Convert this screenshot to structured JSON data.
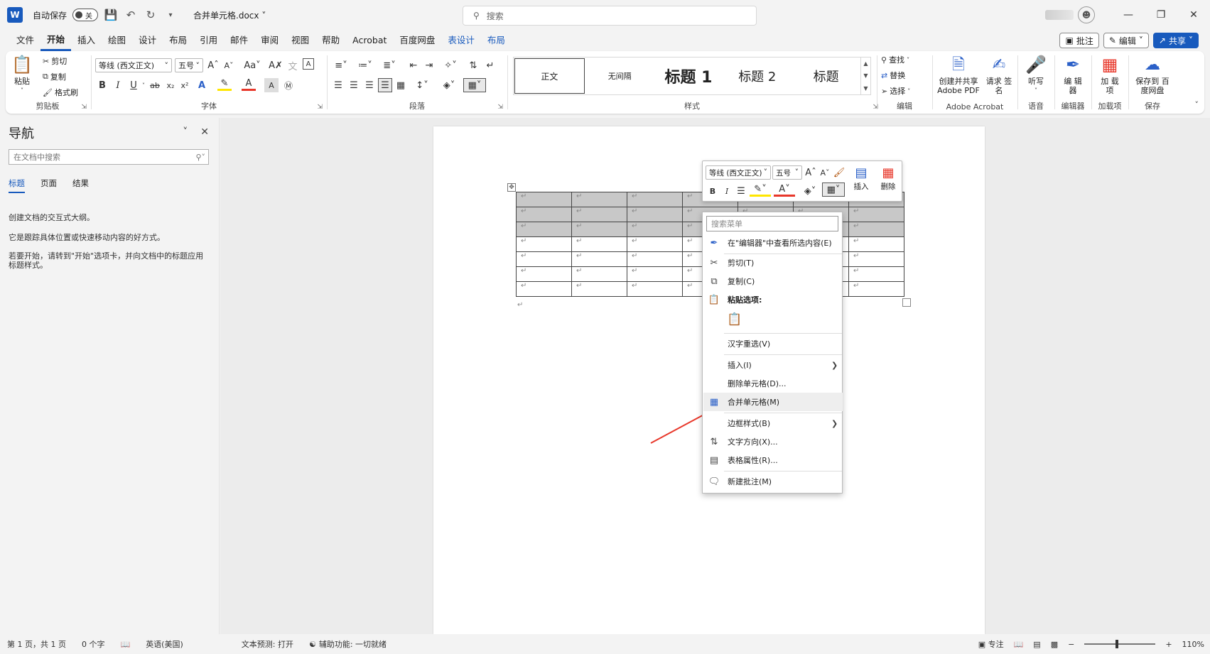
{
  "titlebar": {
    "app_logo": "W",
    "autosave_label": "自动保存",
    "autosave_state": "关",
    "doc_title": "合并单元格.docx",
    "search_placeholder": "搜索"
  },
  "menubar": {
    "tabs": [
      "文件",
      "开始",
      "插入",
      "绘图",
      "设计",
      "布局",
      "引用",
      "邮件",
      "审阅",
      "视图",
      "帮助",
      "Acrobat",
      "百度网盘",
      "表设计",
      "布局"
    ],
    "comment_btn": "批注",
    "edit_btn": "编辑",
    "share_btn": "共享"
  },
  "ribbon": {
    "clipboard": {
      "label": "剪贴板",
      "paste": "粘贴",
      "cut": "剪切",
      "copy": "复制",
      "format_painter": "格式刷"
    },
    "font": {
      "label": "字体",
      "font_name": "等线 (西文正文)",
      "font_size": "五号",
      "bold": "B",
      "italic": "I",
      "underline": "U",
      "strike": "ab",
      "sub": "x₂",
      "sup": "x²",
      "change_case": "Aa"
    },
    "paragraph": {
      "label": "段落"
    },
    "styles": {
      "label": "样式",
      "items": [
        "正文",
        "无间隔",
        "标题 1",
        "标题 2",
        "标题"
      ]
    },
    "editing": {
      "label": "编辑",
      "find": "查找",
      "replace": "替换",
      "select": "选择"
    },
    "acrobat": {
      "label": "Adobe Acrobat",
      "create_share": "创建并共享 Adobe PDF",
      "request_sign": "请求 签名"
    },
    "voice": {
      "label": "语音",
      "dictate": "听写"
    },
    "editor": {
      "label": "编辑器",
      "editor_btn": "编 辑器"
    },
    "addins": {
      "label": "加载项",
      "addins_btn": "加 载项"
    },
    "save": {
      "label": "保存",
      "save_baidu": "保存到 百度网盘"
    }
  },
  "nav": {
    "title": "导航",
    "search_placeholder": "在文档中搜索",
    "tabs": [
      "标题",
      "页面",
      "结果"
    ],
    "text1": "创建文档的交互式大纲。",
    "text2": "它是跟踪具体位置或快速移动内容的好方式。",
    "text3": "若要开始，请转到\"开始\"选项卡，并向文档中的标题应用标题样式。"
  },
  "document": {
    "para_mark": "↵",
    "rows": 7,
    "cols": 7,
    "selected_rows": 3
  },
  "minitoolbar": {
    "font_name": "等线 (西文正文)",
    "font_size": "五号",
    "insert": "插入",
    "delete": "删除"
  },
  "context_menu": {
    "search_placeholder": "搜索菜单",
    "items": [
      {
        "label": "在\"编辑器\"中查看所选内容(E)",
        "icon": "editor-pen-icon"
      },
      {
        "label": "剪切(T)",
        "icon": "scissors-icon"
      },
      {
        "label": "复制(C)",
        "icon": "copy-icon"
      },
      {
        "label": "粘贴选项:",
        "icon": "paste-icon"
      },
      {
        "label": "汉字重选(V)"
      },
      {
        "label": "插入(I)",
        "submenu": true
      },
      {
        "label": "删除单元格(D)..."
      },
      {
        "label": "合并单元格(M)",
        "icon": "merge-cells-icon"
      },
      {
        "label": "边框样式(B)",
        "submenu": true
      },
      {
        "label": "文字方向(X)...",
        "icon": "text-direction-icon"
      },
      {
        "label": "表格属性(R)...",
        "icon": "table-properties-icon"
      },
      {
        "label": "新建批注(M)",
        "icon": "new-comment-icon"
      }
    ]
  },
  "statusbar": {
    "page": "第 1 页，共 1 页",
    "words": "0 个字",
    "language": "英语(美国)",
    "text_predict": "文本预测: 打开",
    "accessibility": "辅助功能: 一切就绪",
    "focus": "专注",
    "zoom": "110%"
  },
  "colors": {
    "brand": "#185abd",
    "arrow": "#e8372a"
  }
}
